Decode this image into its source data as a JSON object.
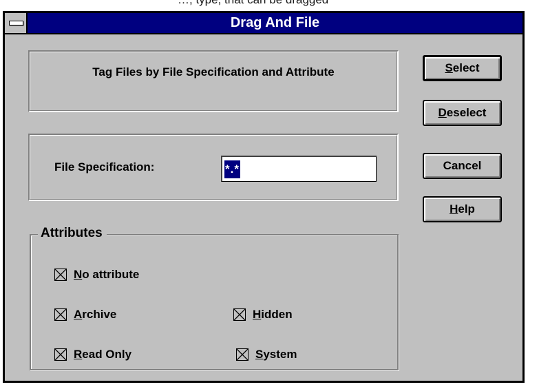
{
  "top_strip_text": "…, type, that can be dragged",
  "window": {
    "title": "Drag And File"
  },
  "header": {
    "text": "Tag Files by File Specification and Attribute"
  },
  "file_spec": {
    "label": "File Specification:",
    "value": "*.*"
  },
  "attributes": {
    "legend": "Attributes",
    "items": [
      {
        "mnemonic": "N",
        "rest": "o attribute",
        "checked": true
      },
      {
        "mnemonic": "A",
        "rest": "rchive",
        "checked": true
      },
      {
        "mnemonic": "H",
        "rest": "idden",
        "checked": true
      },
      {
        "mnemonic": "R",
        "rest": "ead Only",
        "checked": true
      },
      {
        "mnemonic": "S",
        "rest": "ystem",
        "checked": true
      }
    ]
  },
  "buttons": [
    {
      "mnemonic": "S",
      "rest": "elect",
      "default": true
    },
    {
      "mnemonic": "D",
      "rest": "eselect",
      "default": false
    },
    {
      "mnemonic": "",
      "rest": "Cancel",
      "default": false
    },
    {
      "mnemonic": "H",
      "rest": "elp",
      "default": false
    }
  ],
  "colors": {
    "titlebar": "#000080",
    "face": "#c0c0c0",
    "selection": "#000080"
  }
}
